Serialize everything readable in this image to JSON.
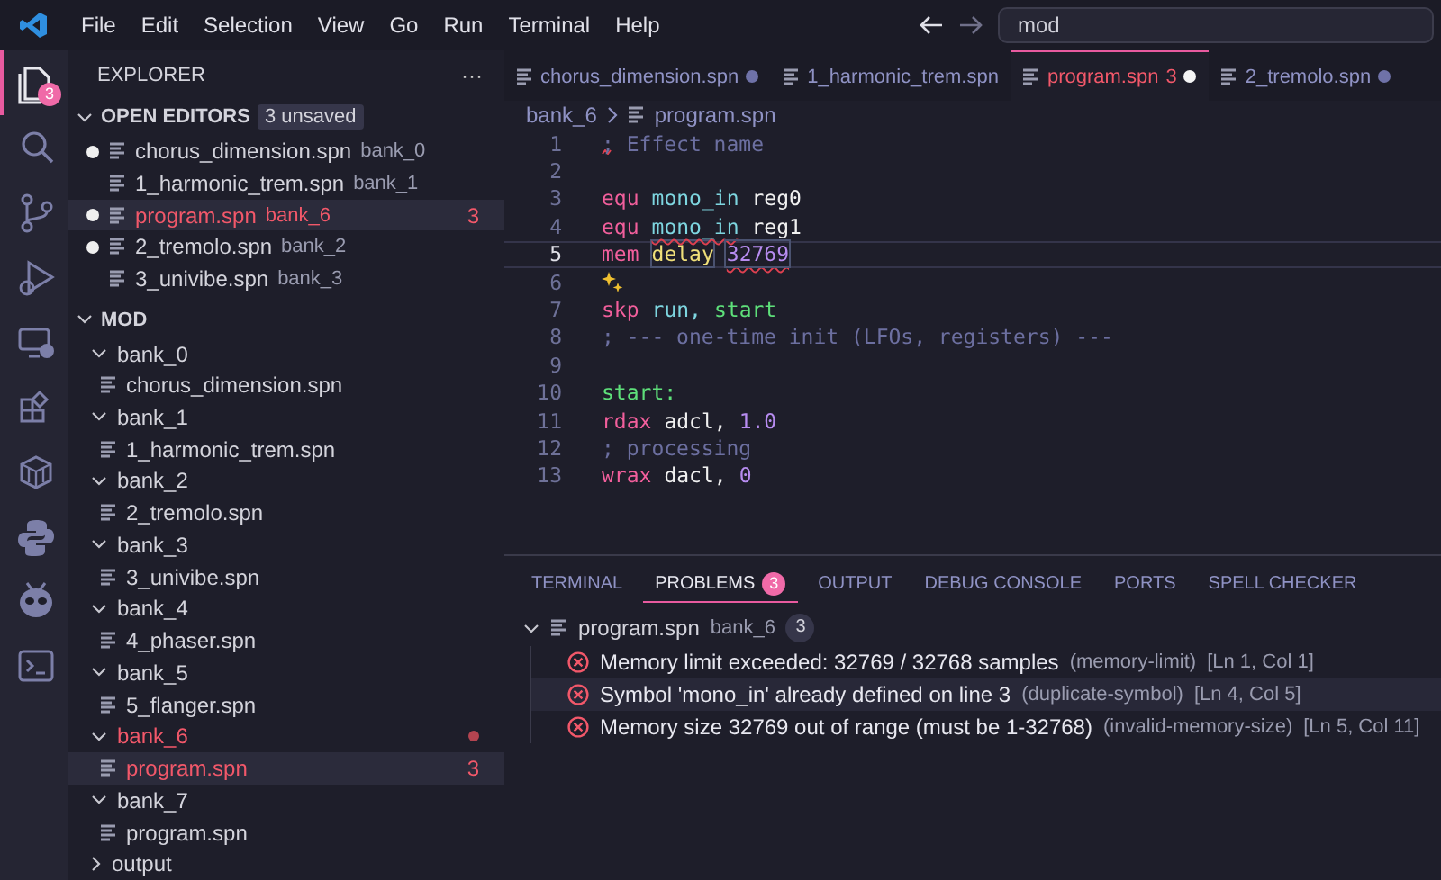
{
  "menu": [
    "File",
    "Edit",
    "Selection",
    "View",
    "Go",
    "Run",
    "Terminal",
    "Help"
  ],
  "nav": {
    "back_enabled": true,
    "forward_enabled": false
  },
  "search": {
    "value": "mod"
  },
  "activity": [
    {
      "kind": "files",
      "selected": true,
      "badge": "3"
    },
    {
      "kind": "search",
      "selected": false
    },
    {
      "kind": "git",
      "selected": false
    },
    {
      "kind": "debug",
      "selected": false
    },
    {
      "kind": "remote",
      "selected": false
    },
    {
      "kind": "extensions",
      "selected": false
    },
    {
      "kind": "box",
      "selected": false
    },
    {
      "kind": "python",
      "selected": false
    },
    {
      "kind": "alien",
      "selected": false
    },
    {
      "kind": "terminal",
      "selected": false
    }
  ],
  "explorer": {
    "title": "EXPLORER",
    "more": "···",
    "open_editors": {
      "title": "OPEN EDITORS",
      "badge": "3 unsaved",
      "expanded": true,
      "items": [
        {
          "name": "chorus_dimension.spn",
          "folder": "bank_0",
          "dirty": true,
          "error": false,
          "selected": false
        },
        {
          "name": "1_harmonic_trem.spn",
          "folder": "bank_1",
          "dirty": false,
          "error": false,
          "selected": false
        },
        {
          "name": "program.spn",
          "folder": "bank_6",
          "dirty": true,
          "error": true,
          "count": "3",
          "selected": true
        },
        {
          "name": "2_tremolo.spn",
          "folder": "bank_2",
          "dirty": true,
          "error": false,
          "selected": false
        },
        {
          "name": "3_univibe.spn",
          "folder": "bank_3",
          "dirty": false,
          "error": false,
          "selected": false
        }
      ]
    },
    "folder": {
      "title": "MOD",
      "expanded": true,
      "children": [
        {
          "name": "bank_0",
          "expanded": true,
          "error": false,
          "children": [
            {
              "name": "chorus_dimension.spn",
              "error": false,
              "selected": false
            }
          ]
        },
        {
          "name": "bank_1",
          "expanded": true,
          "error": false,
          "children": [
            {
              "name": "1_harmonic_trem.spn",
              "error": false,
              "selected": false
            }
          ]
        },
        {
          "name": "bank_2",
          "expanded": true,
          "error": false,
          "children": [
            {
              "name": "2_tremolo.spn",
              "error": false,
              "selected": false
            }
          ]
        },
        {
          "name": "bank_3",
          "expanded": true,
          "error": false,
          "children": [
            {
              "name": "3_univibe.spn",
              "error": false,
              "selected": false
            }
          ]
        },
        {
          "name": "bank_4",
          "expanded": true,
          "error": false,
          "children": [
            {
              "name": "4_phaser.spn",
              "error": false,
              "selected": false
            }
          ]
        },
        {
          "name": "bank_5",
          "expanded": true,
          "error": false,
          "children": [
            {
              "name": "5_flanger.spn",
              "error": false,
              "selected": false
            }
          ]
        },
        {
          "name": "bank_6",
          "expanded": true,
          "error": true,
          "children": [
            {
              "name": "program.spn",
              "error": true,
              "count": "3",
              "selected": true
            }
          ]
        },
        {
          "name": "bank_7",
          "expanded": true,
          "error": false,
          "children": [
            {
              "name": "program.spn",
              "error": false,
              "selected": false
            }
          ]
        },
        {
          "name": "output",
          "expanded": false,
          "error": false
        }
      ]
    }
  },
  "tabs": [
    {
      "label": "chorus_dimension.spn",
      "dirty": true,
      "error": false,
      "selected": false
    },
    {
      "label": "1_harmonic_trem.spn",
      "dirty": false,
      "error": false,
      "selected": false
    },
    {
      "label": "program.spn",
      "count": "3",
      "dirty": true,
      "error": true,
      "selected": true
    },
    {
      "label": "2_tremolo.spn",
      "dirty": true,
      "error": false,
      "selected": false
    }
  ],
  "breadcrumb": [
    "bank_6",
    "program.spn"
  ],
  "code": [
    {
      "n": "1",
      "tokens": [
        {
          "kind": "comment",
          "text": "; Effect name"
        }
      ],
      "error_mark": true
    },
    {
      "n": "2"
    },
    {
      "n": "3",
      "tokens": [
        {
          "kind": "kw",
          "text": "equ"
        },
        {
          "kind": "sym",
          "text": "mono_in"
        },
        {
          "kind": "plain",
          "text": "reg0"
        }
      ]
    },
    {
      "n": "4",
      "tokens": [
        {
          "kind": "kw",
          "text": "equ"
        },
        {
          "kind": "sym",
          "text": "mono_in",
          "error": true
        },
        {
          "kind": "plain",
          "text": "reg1"
        }
      ]
    },
    {
      "n": "5",
      "current": true,
      "tokens": [
        {
          "kind": "kw",
          "text": "mem"
        },
        {
          "kind": "name",
          "text": "delay",
          "boxed": true
        },
        {
          "kind": "num",
          "text": "32769",
          "boxed": true,
          "error": true
        }
      ]
    },
    {
      "n": "6",
      "hint": true
    },
    {
      "n": "7",
      "tokens": [
        {
          "kind": "kw",
          "text": "skp"
        },
        {
          "kind": "sym",
          "text": "run,"
        },
        {
          "kind": "label",
          "text": "start"
        }
      ]
    },
    {
      "n": "8",
      "tokens": [
        {
          "kind": "comment",
          "text": "; --- one-time init (LFOs, registers) ---"
        }
      ]
    },
    {
      "n": "9"
    },
    {
      "n": "10",
      "tokens": [
        {
          "kind": "label",
          "text": "start:"
        }
      ]
    },
    {
      "n": "11",
      "tokens": [
        {
          "kind": "kw",
          "text": "rdax"
        },
        {
          "kind": "plain",
          "text": "adcl,"
        },
        {
          "kind": "num",
          "text": "1.0"
        }
      ]
    },
    {
      "n": "12",
      "tokens": [
        {
          "kind": "comment",
          "text": "; processing"
        }
      ]
    },
    {
      "n": "13",
      "tokens": [
        {
          "kind": "kw",
          "text": "wrax"
        },
        {
          "kind": "plain",
          "text": "dacl,"
        },
        {
          "kind": "num",
          "text": "0"
        }
      ]
    }
  ],
  "panel": {
    "tabs": [
      {
        "label": "TERMINAL",
        "selected": false
      },
      {
        "label": "PROBLEMS",
        "badge": "3",
        "selected": true
      },
      {
        "label": "OUTPUT",
        "selected": false
      },
      {
        "label": "DEBUG CONSOLE",
        "selected": false
      },
      {
        "label": "PORTS",
        "selected": false
      },
      {
        "label": "SPELL CHECKER",
        "selected": false
      }
    ],
    "group": {
      "file": "program.spn",
      "folder": "bank_6",
      "count": "3",
      "expanded": true
    },
    "problems": [
      {
        "message": "Memory limit exceeded: 32769 / 32768 samples",
        "code": "(memory-limit)",
        "location": "[Ln 1, Col 1]",
        "selected": false
      },
      {
        "message": "Symbol 'mono_in' already defined on line 3",
        "code": "(duplicate-symbol)",
        "location": "[Ln 4, Col 5]",
        "selected": true
      },
      {
        "message": "Memory size 32769 out of range (must be 1-32768)",
        "code": "(invalid-memory-size)",
        "location": "[Ln 5, Col 11]",
        "selected": false
      }
    ]
  }
}
